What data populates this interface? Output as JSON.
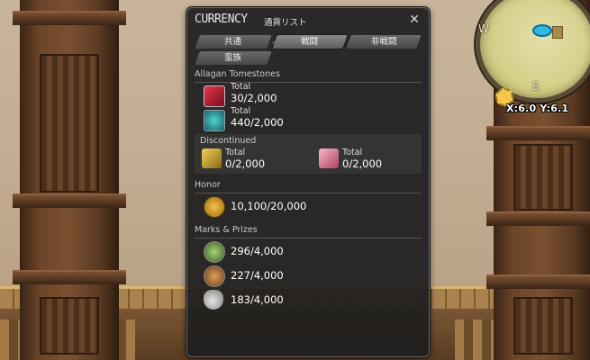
{
  "window": {
    "title": "CURRENCY",
    "subtitle": "通貨リスト",
    "tabs": [
      {
        "label": "共通",
        "active": false
      },
      {
        "label": "戦闘",
        "active": true
      },
      {
        "label": "非戦闘",
        "active": false
      },
      {
        "label": "蛮族",
        "active": false
      }
    ]
  },
  "sections": {
    "tomestones": {
      "header": "Allagan Tomestones",
      "items": [
        {
          "icon": "red-tomestone-icon",
          "label": "Total",
          "amount": "30/2,000"
        },
        {
          "icon": "teal-tomestone-icon",
          "label": "Total",
          "amount": "440/2,000"
        }
      ],
      "discontinued": {
        "header": "Discontinued",
        "items": [
          {
            "icon": "gold-tomestone-icon",
            "label": "Total",
            "amount": "0/2,000"
          },
          {
            "icon": "pink-tomestone-icon",
            "label": "Total",
            "amount": "0/2,000"
          }
        ]
      }
    },
    "honor": {
      "header": "Honor",
      "items": [
        {
          "icon": "honor-coin-icon",
          "amount": "10,100/20,000"
        }
      ]
    },
    "marks": {
      "header": "Marks & Prizes",
      "items": [
        {
          "icon": "green-medal-icon",
          "amount": "296/4,000"
        },
        {
          "icon": "bronze-medal-icon",
          "amount": "227/4,000"
        },
        {
          "icon": "coin-pouch-icon",
          "amount": "183/4,000"
        }
      ]
    }
  },
  "minimap": {
    "compass_w": "W",
    "compass_s": "S",
    "coords": "X:6.0 Y:6.1"
  },
  "colors": {
    "window_bg": "#1e1e1e",
    "tab_active": "#8a8a8a",
    "text": "#ffffff"
  }
}
